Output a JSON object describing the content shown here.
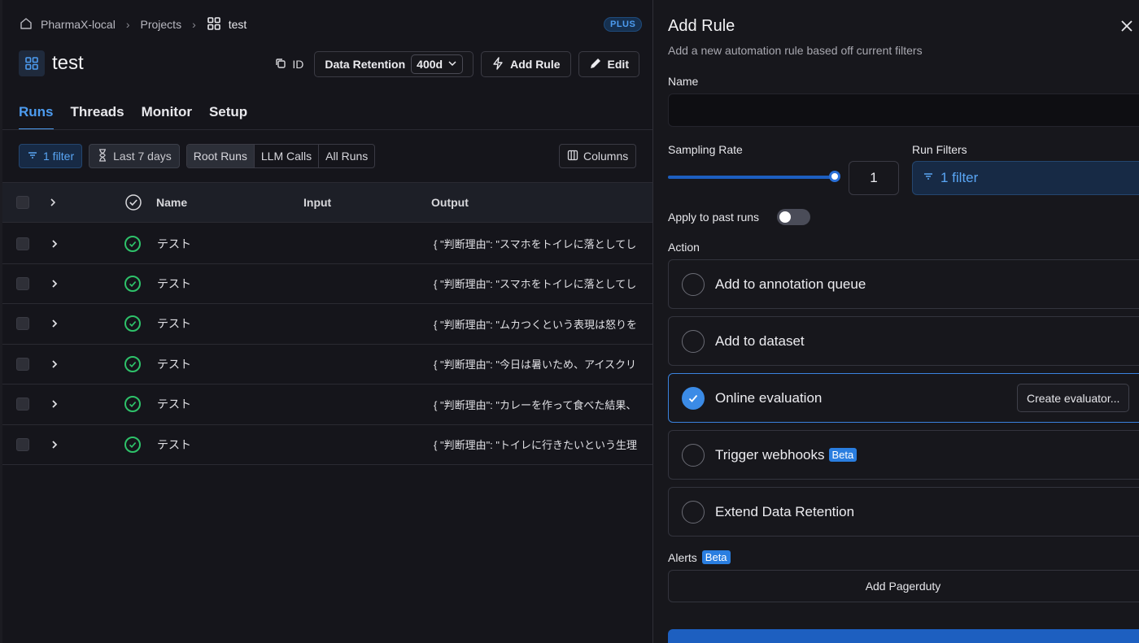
{
  "breadcrumb": {
    "workspace": "PharmaX-local",
    "section": "Projects",
    "project": "test"
  },
  "plan_badge": "PLUS",
  "project": {
    "title": "test",
    "id_label": "ID",
    "retention_label": "Data Retention",
    "retention_value": "400d",
    "add_rule_label": "Add Rule",
    "edit_label": "Edit"
  },
  "tabs": [
    "Runs",
    "Threads",
    "Monitor",
    "Setup"
  ],
  "toolbar": {
    "filter": "1 filter",
    "time": "Last 7 days",
    "segments": [
      "Root Runs",
      "LLM Calls",
      "All Runs"
    ],
    "columns": "Columns"
  },
  "table": {
    "headers": {
      "name": "Name",
      "input": "Input",
      "output": "Output"
    },
    "rows": [
      {
        "name": "テスト",
        "output": "{ \"判断理由\": \"スマホをトイレに落としてし"
      },
      {
        "name": "テスト",
        "output": "{ \"判断理由\": \"スマホをトイレに落としてし"
      },
      {
        "name": "テスト",
        "output": "{ \"判断理由\": \"ムカつくという表現は怒りを"
      },
      {
        "name": "テスト",
        "output": "{ \"判断理由\": \"今日は暑いため、アイスクリ"
      },
      {
        "name": "テスト",
        "output": "{ \"判断理由\": \"カレーを作って食べた結果、"
      },
      {
        "name": "テスト",
        "output": "{ \"判断理由\": \"トイレに行きたいという生理"
      }
    ]
  },
  "panel": {
    "title": "Add Rule",
    "subtitle": "Add a new automation rule based off current filters",
    "name_label": "Name",
    "name_value": "",
    "sampling_label": "Sampling Rate",
    "sampling_value": "1",
    "sampling_fraction": 1,
    "run_filters_label": "Run Filters",
    "run_filters_value": "1 filter",
    "apply_past_label": "Apply to past runs",
    "apply_past_on": false,
    "action_label": "Action",
    "actions": [
      {
        "label": "Add to annotation queue",
        "selected": false
      },
      {
        "label": "Add to dataset",
        "selected": false
      },
      {
        "label": "Online evaluation",
        "selected": true
      },
      {
        "label": "Trigger webhooks",
        "selected": false,
        "badge": "Beta"
      },
      {
        "label": "Extend Data Retention",
        "selected": false
      }
    ],
    "create_evaluator": "Create evaluator...",
    "alerts_label": "Alerts",
    "alerts_badge": "Beta",
    "pagerduty": "Add Pagerduty"
  },
  "colors": {
    "accent": "#4d9cf0",
    "success": "#2ec26a",
    "primary_button": "#1d5fc0"
  }
}
